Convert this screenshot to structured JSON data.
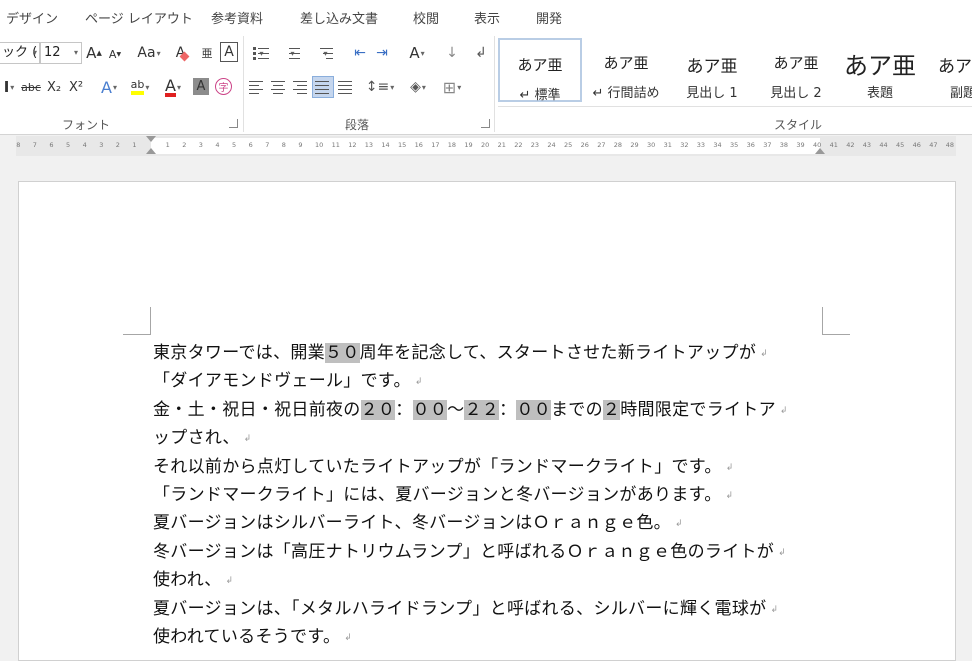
{
  "ribbon_tabs": [
    "デザイン",
    "ページ レイアウト",
    "参考資料",
    "差し込み文書",
    "校閲",
    "表示",
    "開発"
  ],
  "font_group": {
    "font_name": "ック (",
    "font_size": "12",
    "grow_label": "A",
    "shrink_label": "A",
    "case_label": "Aa",
    "clear_label": "A",
    "phonetic_label": "亜",
    "border_label": "A",
    "bold_label": "I",
    "strike_label": "abc",
    "sub_label": "X₂",
    "sup_label": "X²",
    "effect_label": "A",
    "highlight_label": "ab",
    "color_label": "A",
    "shade_label": "A",
    "enclose_label": "字",
    "label": "フォント",
    "font_color": "#e02020",
    "highlight_color": "#ffff00"
  },
  "paragraph_group": {
    "label": "段落"
  },
  "styles_group": {
    "label": "スタイル",
    "items": [
      {
        "sample": "あア亜",
        "name": "↵ 標準"
      },
      {
        "sample": "あア亜",
        "name": "↵ 行間詰め"
      },
      {
        "sample": "あア亜",
        "name": "見出し 1"
      },
      {
        "sample": "あア亜",
        "name": "見出し 2"
      },
      {
        "sample": "あア亜",
        "name": "表題"
      },
      {
        "sample": "あア",
        "name": "副題"
      }
    ]
  },
  "ruler": {
    "left_numbers": [
      "8",
      "7",
      "6",
      "5",
      "4",
      "3",
      "2",
      "1"
    ],
    "numbers": [
      "1",
      "2",
      "3",
      "4",
      "5",
      "6",
      "7",
      "8",
      "9",
      "10",
      "11",
      "12",
      "13",
      "14",
      "15",
      "16",
      "17",
      "18",
      "19",
      "20",
      "21",
      "22",
      "23",
      "24",
      "25",
      "26",
      "27",
      "28",
      "29",
      "30",
      "31",
      "32",
      "33",
      "34",
      "35",
      "36",
      "37",
      "38",
      "39",
      "40"
    ],
    "right_numbers": [
      "41",
      "42",
      "43",
      "44",
      "45",
      "46",
      "47",
      "48"
    ]
  },
  "document": {
    "paragraphs": [
      [
        {
          "t": "東京タワーでは、開業"
        },
        {
          "t": "５０",
          "hl": true
        },
        {
          "t": "周年を記念して、スタートさせた新ライトアップが"
        }
      ],
      [
        {
          "t": "「ダイアモンドヴェール」です。"
        }
      ],
      [
        {
          "t": "金・土・祝日・祝日前夜の"
        },
        {
          "t": "２０",
          "hl": true
        },
        {
          "t": "："
        },
        {
          "t": "００",
          "hl": true
        },
        {
          "t": "～"
        },
        {
          "t": "２２",
          "hl": true
        },
        {
          "t": "："
        },
        {
          "t": "００",
          "hl": true
        },
        {
          "t": "までの"
        },
        {
          "t": "２",
          "hl": true
        },
        {
          "t": "時間限定でライトア"
        }
      ],
      [
        {
          "t": "ップされ、"
        }
      ],
      [
        {
          "t": "それ以前から点灯していたライトアップが「ランドマークライト」です。"
        }
      ],
      [
        {
          "t": "「ランドマークライト」には、夏バージョンと冬バージョンがあります。"
        }
      ],
      [
        {
          "t": "夏バージョンはシルバーライト、冬バージョンはＯｒａｎｇｅ色。"
        }
      ],
      [
        {
          "t": "冬バージョンは「高圧ナトリウムランプ」と呼ばれるＯｒａｎｇｅ色のライトが"
        }
      ],
      [
        {
          "t": "使われ、"
        }
      ],
      [
        {
          "t": "夏バージョンは、「メタルハライドランプ」と呼ばれる、シルバーに輝く電球が"
        }
      ],
      [
        {
          "t": "使われているそうです。"
        }
      ]
    ]
  }
}
